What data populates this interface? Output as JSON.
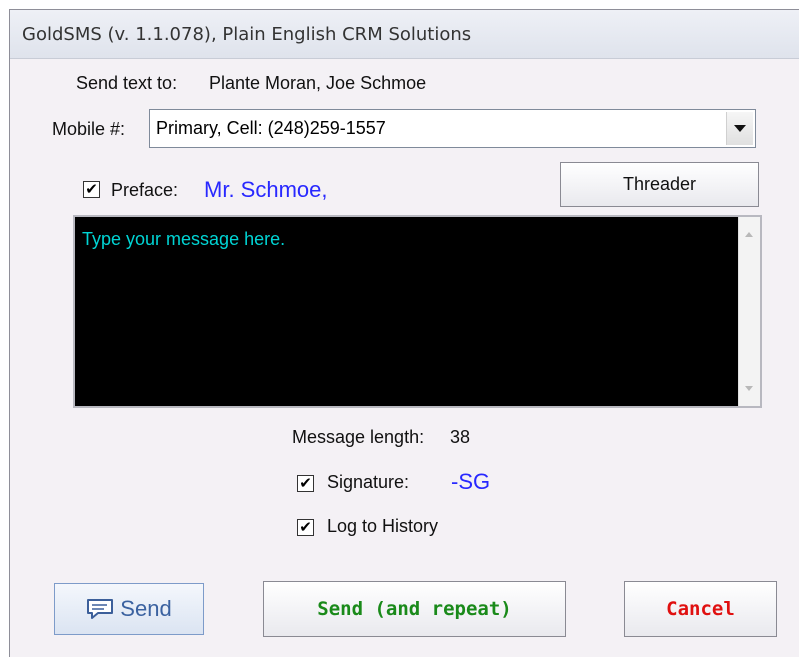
{
  "window": {
    "title": "GoldSMS (v. 1.1.078), Plain English CRM Solutions"
  },
  "recipient": {
    "label": "Send text to:",
    "name": "Plante Moran, Joe Schmoe"
  },
  "mobile": {
    "label": "Mobile #:",
    "selected": "Primary, Cell: (248)259-1557"
  },
  "preface": {
    "checked": "✔",
    "label": "Preface:",
    "value": "Mr. Schmoe,"
  },
  "threader_button": "Threader",
  "message": {
    "placeholder": "Type your message here."
  },
  "message_length": {
    "label": "Message length:",
    "value": "38"
  },
  "signature": {
    "checked": "✔",
    "label": "Signature:",
    "value": "-SG"
  },
  "log_history": {
    "checked": "✔",
    "label": "Log to History"
  },
  "buttons": {
    "send": "Send",
    "send_repeat": "Send (and repeat)",
    "cancel": "Cancel"
  },
  "colors": {
    "accent_blue": "#2828ff",
    "message_text": "#00d4d4",
    "send_repeat": "#1a8a1a",
    "cancel": "#e01010"
  },
  "icons": {
    "send": "chat-bubble-icon"
  }
}
